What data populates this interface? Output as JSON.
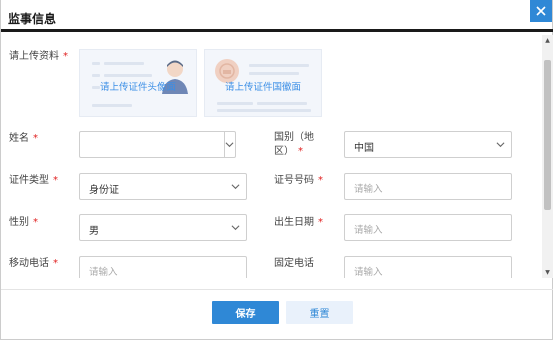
{
  "dialog": {
    "title": "监事信息",
    "colors": {
      "accent": "#2f88d6",
      "required": "#e02020"
    }
  },
  "upload": {
    "label": "请上传资料",
    "required_mark": "*",
    "front_text": "请上传证件头像面",
    "back_text": "请上传证件国徽面"
  },
  "form": {
    "name": {
      "label": "姓名",
      "value": ""
    },
    "nationality": {
      "label_line1": "国别（地",
      "label_line2": "区）",
      "value": "中国"
    },
    "id_type": {
      "label": "证件类型",
      "value": "身份证"
    },
    "id_number": {
      "label": "证号号码",
      "placeholder": "请输入"
    },
    "gender": {
      "label": "性别",
      "value": "男"
    },
    "birth_date": {
      "label": "出生日期",
      "placeholder": "请输入"
    },
    "mobile": {
      "label": "移动电话",
      "placeholder": "请输入"
    },
    "landline": {
      "label": "固定电话",
      "placeholder": "请输入"
    },
    "required_mark": "*"
  },
  "footer": {
    "save_label": "保存",
    "reset_label": "重置"
  },
  "icons": {
    "close": "close-icon",
    "chevron": "chevron-down-icon",
    "scroll_up": "scroll-up-icon",
    "scroll_down": "scroll-down-icon"
  }
}
